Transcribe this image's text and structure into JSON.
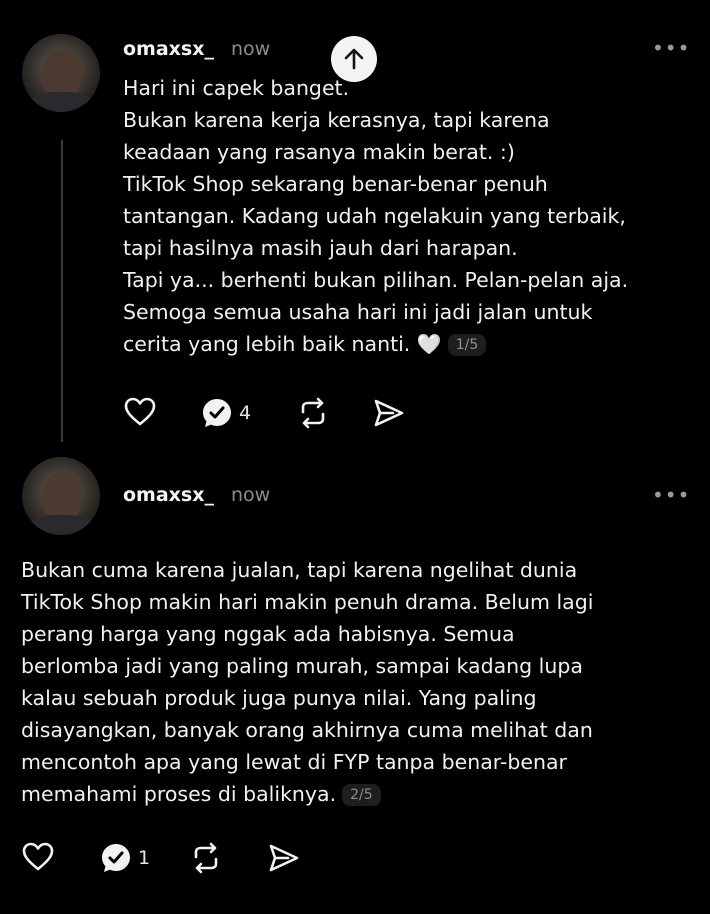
{
  "posts": [
    {
      "username": "omaxsx_",
      "time": "now",
      "more_label": "•••",
      "text": "Hari ini capek banget.\nBukan karena kerja kerasnya, tapi karena\nkeadaan yang rasanya makin berat. :)\nTikTok Shop sekarang benar-benar penuh\ntantangan. Kadang udah ngelakuin yang terbaik,\ntapi hasilnya masih jauh dari harapan.\nTapi ya... berhenti bukan pilihan. Pelan-pelan aja.\nSemoga semua usaha hari ini jadi jalan untuk\ncerita yang lebih baik nanti.",
      "emoji": "🤍",
      "page": "1/5",
      "reply_count": "4"
    },
    {
      "username": "omaxsx_",
      "time": "now",
      "more_label": "•••",
      "text": "Bukan cuma karena jualan, tapi karena ngelihat dunia\nTikTok Shop makin hari makin penuh drama. Belum lagi\nperang harga yang nggak ada habisnya. Semua\nberlomba jadi yang paling murah, sampai kadang lupa\nkalau sebuah produk juga punya nilai. Yang paling\ndisayangkan, banyak orang akhirnya cuma melihat dan\nmencontoh apa yang lewat di FYP tanpa benar-benar\nmemahami proses di baliknya.",
      "page": "2/5",
      "reply_count": "1"
    }
  ],
  "icons": {
    "scroll_up": "arrow-up-icon",
    "like": "heart-icon",
    "reply": "reply-bubble-check-icon",
    "repost": "repost-icon",
    "share": "send-icon"
  },
  "colors": {
    "background": "#000000",
    "text": "#f1f1f1",
    "muted": "#8d8d8d"
  }
}
